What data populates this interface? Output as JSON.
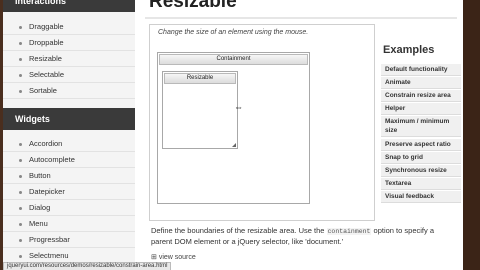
{
  "sidebar": {
    "interactions_heading": "Interactions",
    "interactions": [
      "Draggable",
      "Droppable",
      "Resizable",
      "Selectable",
      "Sortable"
    ],
    "widgets_heading": "Widgets",
    "widgets": [
      "Accordion",
      "Autocomplete",
      "Button",
      "Datepicker",
      "Dialog",
      "Menu",
      "Progressbar",
      "Selectmenu"
    ]
  },
  "main": {
    "title": "Resizable",
    "demo_caption": "Change the size of an element using the mouse.",
    "container_label": "Containment",
    "resizable_label": "Resizable",
    "desc_text_1": "Define the boundaries of the resizable area. Use the ",
    "desc_code": "containment",
    "desc_text_2": " option to specify a parent DOM element or a jQuery selector, like 'document.'",
    "view_source": "view source"
  },
  "examples": {
    "heading": "Examples",
    "items": [
      "Default functionality",
      "Animate",
      "Constrain resize area",
      "Helper",
      "Maximum / minimum size",
      "Preserve aspect ratio",
      "Snap to grid",
      "Synchronous resize",
      "Textarea",
      "Visual feedback"
    ]
  },
  "status_bar": {
    "url": "jqueryui.com/resources/demos/resizable/constrain-area.html"
  }
}
